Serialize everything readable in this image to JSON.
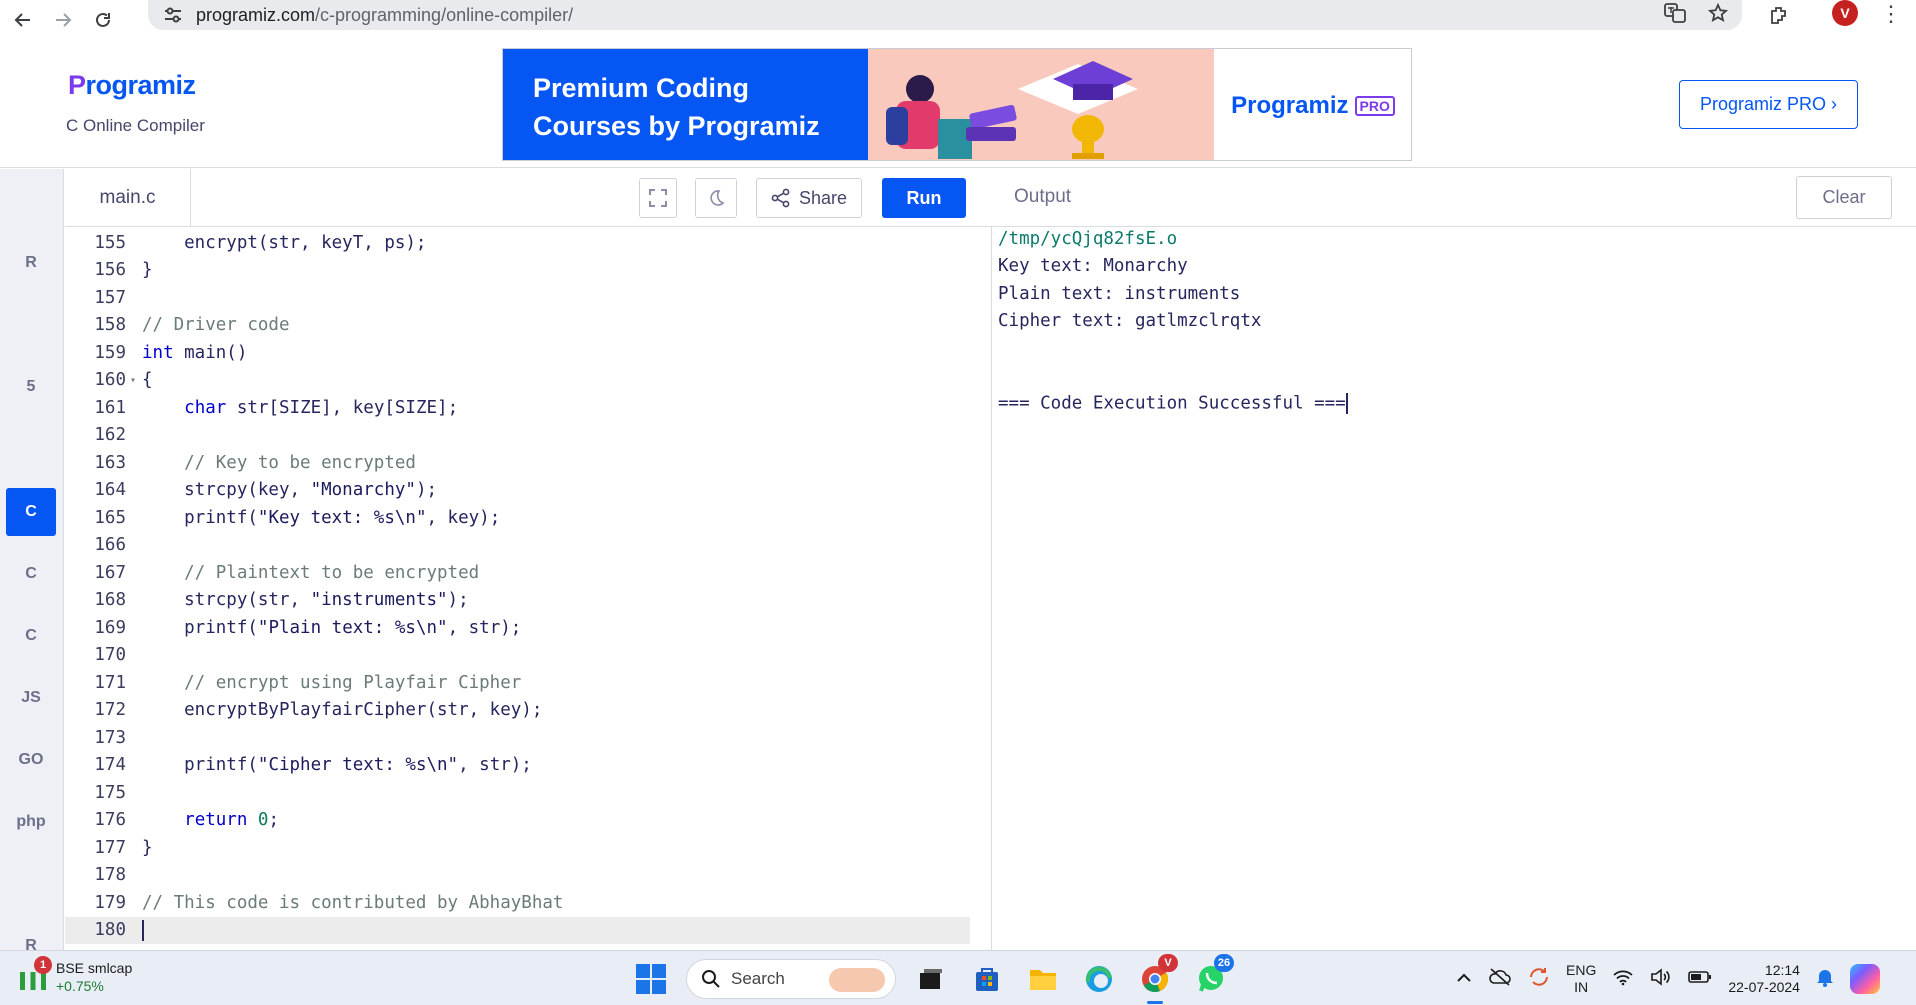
{
  "browser": {
    "url_host": "programiz.com",
    "url_path": "/c-programming/online-compiler/",
    "profile_initial": "V"
  },
  "header": {
    "logo_text": "rogramiz",
    "logo_mark": "P",
    "subtitle": "C Online Compiler",
    "banner_line1": "Premium Coding",
    "banner_line2": "Courses by Programiz",
    "banner_logo": "Programiz",
    "banner_tag": "PRO",
    "pro_button": "Programiz PRO ›"
  },
  "lang_rail": {
    "items": [
      {
        "name": "python",
        "label": "",
        "icon": "python-icon"
      },
      {
        "name": "r",
        "label": "R",
        "icon": "r-icon"
      },
      {
        "name": "sql",
        "label": "",
        "icon": "database-icon"
      },
      {
        "name": "html",
        "label": "5",
        "icon": "html5-icon"
      },
      {
        "name": "java",
        "label": "",
        "icon": "java-icon"
      },
      {
        "name": "c",
        "label": "C",
        "icon": "c-icon",
        "active": true
      },
      {
        "name": "cpp",
        "label": "C",
        "icon": "cpp-icon"
      },
      {
        "name": "csharp",
        "label": "C",
        "icon": "csharp-icon"
      },
      {
        "name": "js",
        "label": "JS",
        "icon": "js-icon"
      },
      {
        "name": "go",
        "label": "GO",
        "icon": "go-icon"
      },
      {
        "name": "php",
        "label": "php",
        "icon": "php-icon"
      },
      {
        "name": "swift",
        "label": "",
        "icon": "swift-icon"
      },
      {
        "name": "rust",
        "label": "R",
        "icon": "rust-icon"
      }
    ]
  },
  "editor": {
    "file_tab": "main.c",
    "share_label": "Share",
    "run_label": "Run",
    "lines": [
      {
        "n": "155",
        "tokens": [
          {
            "t": "    encrypt(str, keyT, ps);",
            "c": ""
          }
        ]
      },
      {
        "n": "156",
        "tokens": [
          {
            "t": "}",
            "c": ""
          }
        ]
      },
      {
        "n": "157",
        "tokens": []
      },
      {
        "n": "158",
        "tokens": [
          {
            "t": "// Driver code",
            "c": "com"
          }
        ]
      },
      {
        "n": "159",
        "tokens": [
          {
            "t": "int",
            "c": "kw"
          },
          {
            "t": " main()",
            "c": ""
          }
        ]
      },
      {
        "n": "160",
        "fold": true,
        "tokens": [
          {
            "t": "{",
            "c": ""
          }
        ]
      },
      {
        "n": "161",
        "tokens": [
          {
            "t": "    ",
            "c": ""
          },
          {
            "t": "char",
            "c": "kw"
          },
          {
            "t": " str[SIZE], key[SIZE];",
            "c": ""
          }
        ]
      },
      {
        "n": "162",
        "tokens": []
      },
      {
        "n": "163",
        "tokens": [
          {
            "t": "    // Key to be encrypted",
            "c": "com"
          }
        ]
      },
      {
        "n": "164",
        "tokens": [
          {
            "t": "    strcpy(key, ",
            "c": ""
          },
          {
            "t": "\"Monarchy\"",
            "c": "str"
          },
          {
            "t": ");",
            "c": ""
          }
        ]
      },
      {
        "n": "165",
        "tokens": [
          {
            "t": "    printf(",
            "c": ""
          },
          {
            "t": "\"Key text: %s\\n\"",
            "c": "str"
          },
          {
            "t": ", key);",
            "c": ""
          }
        ]
      },
      {
        "n": "166",
        "tokens": []
      },
      {
        "n": "167",
        "tokens": [
          {
            "t": "    // Plaintext to be encrypted",
            "c": "com"
          }
        ]
      },
      {
        "n": "168",
        "tokens": [
          {
            "t": "    strcpy(str, ",
            "c": ""
          },
          {
            "t": "\"instruments\"",
            "c": "str"
          },
          {
            "t": ");",
            "c": ""
          }
        ]
      },
      {
        "n": "169",
        "tokens": [
          {
            "t": "    printf(",
            "c": ""
          },
          {
            "t": "\"Plain text: %s\\n\"",
            "c": "str"
          },
          {
            "t": ", str);",
            "c": ""
          }
        ]
      },
      {
        "n": "170",
        "tokens": []
      },
      {
        "n": "171",
        "tokens": [
          {
            "t": "    // encrypt using Playfair Cipher",
            "c": "com"
          }
        ]
      },
      {
        "n": "172",
        "tokens": [
          {
            "t": "    encryptByPlayfairCipher(str, key);",
            "c": ""
          }
        ]
      },
      {
        "n": "173",
        "tokens": []
      },
      {
        "n": "174",
        "tokens": [
          {
            "t": "    printf(",
            "c": ""
          },
          {
            "t": "\"Cipher text: %s\\n\"",
            "c": "str"
          },
          {
            "t": ", str);",
            "c": ""
          }
        ]
      },
      {
        "n": "175",
        "tokens": []
      },
      {
        "n": "176",
        "tokens": [
          {
            "t": "    ",
            "c": ""
          },
          {
            "t": "return",
            "c": "kw"
          },
          {
            "t": " ",
            "c": ""
          },
          {
            "t": "0",
            "c": "num"
          },
          {
            "t": ";",
            "c": ""
          }
        ]
      },
      {
        "n": "177",
        "tokens": [
          {
            "t": "}",
            "c": ""
          }
        ]
      },
      {
        "n": "178",
        "tokens": []
      },
      {
        "n": "179",
        "tokens": [
          {
            "t": "// This code is contributed by AbhayBhat",
            "c": "com"
          }
        ]
      },
      {
        "n": "180",
        "current": true,
        "tokens": []
      }
    ]
  },
  "output": {
    "title": "Output",
    "clear_label": "Clear",
    "lines": [
      {
        "text": "/tmp/ycQjq82fsE.o",
        "kind": "path"
      },
      {
        "text": "Key text: Monarchy",
        "kind": "out"
      },
      {
        "text": "Plain text: instruments",
        "kind": "out"
      },
      {
        "text": "Cipher text: gatlmzclrqtx",
        "kind": "out"
      },
      {
        "text": "",
        "kind": "out"
      },
      {
        "text": "",
        "kind": "out"
      },
      {
        "text": "=== Code Execution Successful ===",
        "kind": "out"
      }
    ]
  },
  "taskbar": {
    "stock_name": "BSE smlcap",
    "stock_change": "+0.75%",
    "stock_badge": "1",
    "search_label": "Search",
    "chrome_badge": "V",
    "whatsapp_badge": "26",
    "lang_line1": "ENG",
    "lang_line2": "IN",
    "time": "12:14",
    "date": "22-07-2024"
  },
  "colors": {
    "brand_blue": "#0556f3",
    "brand_purple": "#7c3aed"
  }
}
